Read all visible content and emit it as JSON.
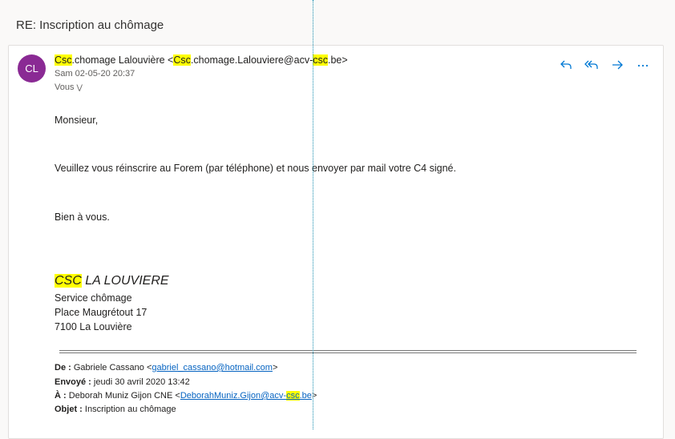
{
  "subject": "RE: Inscription au chômage",
  "sender": {
    "initials": "CL",
    "avatar_color": "#8a2a94",
    "name_pre": "Csc",
    "name_rest": ".chomage Lalouvière <",
    "email_hl1": "Csc",
    "email_mid": ".chomage.Lalouviere@acv-",
    "email_hl2": "csc",
    "email_end": ".be>",
    "date": "Sam 02-05-20 20:37",
    "to": "Vous"
  },
  "actions": {
    "reply": "reply-icon",
    "reply_all": "reply-all-icon",
    "forward": "forward-icon",
    "more": "more-icon"
  },
  "body": {
    "greeting": "Monsieur,",
    "line1": "Veuillez vous réinscrire au Forem (par téléphone) et nous envoyer par mail votre C4 signé.",
    "closing": "Bien à vous."
  },
  "signature": {
    "org_hl": "CSC",
    "org_rest": " LA LOUVIERE",
    "line1": "Service chômage",
    "line2": "Place Maugrétout 17",
    "line3": "7100 La Louvière"
  },
  "quoted": {
    "de_label": "De :",
    "de_name": " Gabriele Cassano <",
    "de_email": "gabriel_cassano@hotmail.com",
    "de_end": ">",
    "envoye_label": "Envoyé :",
    "envoye_value": " jeudi 30 avril 2020 13:42",
    "a_label": "À :",
    "a_name": " Deborah Muniz Gijon CNE <",
    "a_email_pre": "DeborahMuniz.Gijon@acv-",
    "a_email_hl": "csc",
    "a_email_end": ".be",
    "a_end": ">",
    "objet_label": "Objet :",
    "objet_value": " Inscription au chômage"
  },
  "colors": {
    "accent": "#0078d4",
    "highlight": "#ffff00",
    "link": "#0563c1"
  }
}
